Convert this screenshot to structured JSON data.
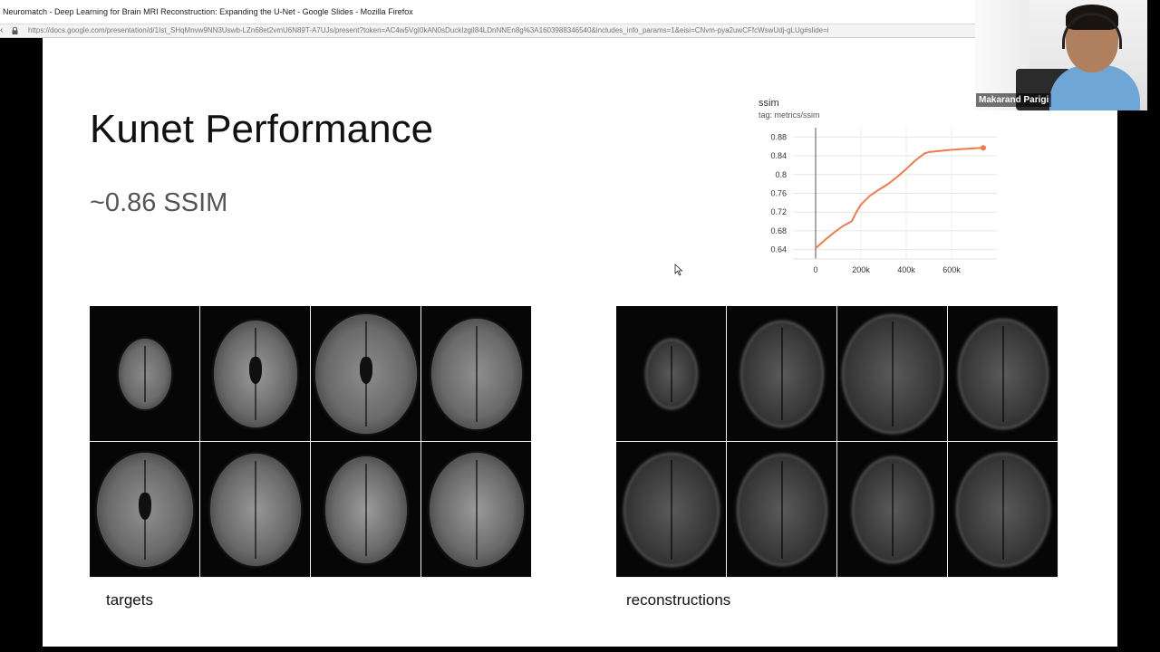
{
  "window": {
    "title": "Neuromatch - Deep Learning for Brain MRI Reconstruction: Expanding the U-Net - Google Slides - Mozilla Firefox",
    "url": "https://docs.google.com/presentation/d/1Ist_SHqMnvw9NN3Uswb-LZn68et2vmU6N89T-A7UJs/present?token=AC4w5VgI0kAN0sDuckIzgiI84LDnNNEn8g%3A1603988346540&includes_info_params=1&eisi=CNvm-pya2uwCFfcWswUdj-gLUg#slide=i"
  },
  "slide": {
    "title": "Kunet Performance",
    "subtitle": "~0.86 SSIM",
    "targets_label": "targets",
    "reconstructions_label": "reconstructions"
  },
  "chart_data": {
    "type": "line",
    "title": "ssim",
    "subtitle": "tag: metrics/ssim",
    "x_ticks": [
      "0",
      "200k",
      "400k",
      "600k"
    ],
    "y_ticks": [
      "0.64",
      "0.68",
      "0.72",
      "0.76",
      "0.8",
      "0.84",
      "0.88"
    ],
    "xlim": [
      -100000,
      800000
    ],
    "ylim": [
      0.62,
      0.9
    ],
    "grid": true,
    "color": "#f07a4b",
    "x": [
      0,
      40000,
      80000,
      120000,
      150000,
      160000,
      180000,
      200000,
      240000,
      280000,
      320000,
      360000,
      400000,
      440000,
      480000,
      500000,
      600000,
      700000,
      740000
    ],
    "y": [
      0.643,
      0.66,
      0.676,
      0.69,
      0.698,
      0.701,
      0.72,
      0.736,
      0.755,
      0.768,
      0.78,
      0.795,
      0.812,
      0.83,
      0.845,
      0.848,
      0.853,
      0.856,
      0.857
    ]
  },
  "webcam": {
    "participant_name": "Makarand Parigi"
  },
  "colors": {
    "series_line": "#f07a4b",
    "slide_background": "#ffffff",
    "page_background": "#000000"
  }
}
